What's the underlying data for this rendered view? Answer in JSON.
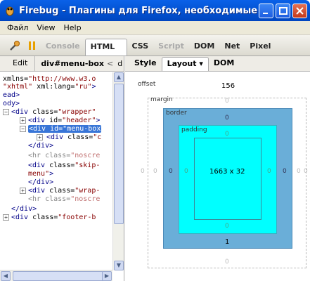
{
  "window": {
    "title": "Firebug - Плагины для Firefox, необходимые веб-..."
  },
  "menu": [
    "Файл",
    "View",
    "Help"
  ],
  "toolbar": {
    "tabs": [
      {
        "label": "Console",
        "state": "disabled"
      },
      {
        "label": "HTML ▾",
        "state": "selected"
      },
      {
        "label": "CSS",
        "state": "normal"
      },
      {
        "label": "Script",
        "state": "disabled"
      },
      {
        "label": "DOM",
        "state": "normal"
      },
      {
        "label": "Net",
        "state": "normal"
      },
      {
        "label": "Pixel Perfect",
        "state": "normal"
      }
    ]
  },
  "html_panel": {
    "edit_label": "Edit",
    "breadcrumb": "div#menu-box",
    "breadcrumb_more": "<",
    "breadcrumb_next": "d",
    "lines": [
      {
        "parts": [
          {
            "t": "xmlns=",
            "c": "attr"
          },
          {
            "t": "\"http://www.w3.o",
            "c": "val"
          }
        ]
      },
      {
        "parts": [
          {
            "t": "\"xhtml\"",
            "c": "val"
          },
          {
            "t": " xml:lang=",
            "c": "attr"
          },
          {
            "t": "\"ru\"",
            "c": "val"
          },
          {
            "t": ">",
            "c": "tag"
          }
        ]
      },
      {
        "parts": [
          {
            "t": "ead>",
            "c": "tag"
          }
        ]
      },
      {
        "parts": [
          {
            "t": "ody>",
            "c": "tag"
          }
        ]
      },
      {
        "parts": [
          {
            "t": "<div ",
            "c": "tag"
          },
          {
            "t": "class=",
            "c": "attr"
          },
          {
            "t": "\"wrapper\"",
            "c": "val"
          }
        ]
      },
      {
        "parts": [
          {
            "t": "<div ",
            "c": "tag"
          },
          {
            "t": "id=",
            "c": "attr"
          },
          {
            "t": "\"header\"",
            "c": "val"
          },
          {
            "t": ">",
            "c": "tag"
          }
        ]
      },
      {
        "parts": [
          {
            "t": "<div id=\"menu-box",
            "c": "sel"
          }
        ]
      },
      {
        "parts": [
          {
            "t": "<div ",
            "c": "tag"
          },
          {
            "t": "class=",
            "c": "attr"
          },
          {
            "t": "\"c",
            "c": "val"
          }
        ]
      },
      {
        "parts": [
          {
            "t": "</div>",
            "c": "tag"
          }
        ]
      },
      {
        "parts": [
          {
            "t": "<hr ",
            "c": "grey"
          },
          {
            "t": "class=",
            "c": "grey"
          },
          {
            "t": "\"noscre",
            "c": "greyval"
          }
        ]
      },
      {
        "parts": [
          {
            "t": "<div ",
            "c": "tag"
          },
          {
            "t": "class=",
            "c": "attr"
          },
          {
            "t": "\"skip-",
            "c": "val"
          }
        ]
      },
      {
        "parts": [
          {
            "t": "menu\"",
            "c": "val"
          },
          {
            "t": ">",
            "c": "tag"
          }
        ]
      },
      {
        "parts": [
          {
            "t": "</div>",
            "c": "tag"
          }
        ]
      },
      {
        "parts": [
          {
            "t": "<div ",
            "c": "tag"
          },
          {
            "t": "class=",
            "c": "attr"
          },
          {
            "t": "\"wrap-",
            "c": "val"
          }
        ]
      },
      {
        "parts": [
          {
            "t": "<hr ",
            "c": "grey"
          },
          {
            "t": "class=",
            "c": "grey"
          },
          {
            "t": "\"noscre",
            "c": "greyval"
          }
        ]
      },
      {
        "parts": [
          {
            "t": "</div>",
            "c": "tag"
          }
        ]
      },
      {
        "parts": [
          {
            "t": "<div ",
            "c": "tag"
          },
          {
            "t": "class=",
            "c": "attr"
          },
          {
            "t": "\"footer-b",
            "c": "val"
          }
        ]
      }
    ]
  },
  "side_panel": {
    "tabs": [
      {
        "label": "Style",
        "state": "normal"
      },
      {
        "label": "Layout ▾",
        "state": "selected"
      },
      {
        "label": "DOM",
        "state": "normal"
      }
    ]
  },
  "layout": {
    "offset_label": "offset",
    "offset_value": "156",
    "margin_label": "margin",
    "margin_top": "0",
    "margin_right": "0",
    "margin_bottom": "0",
    "margin_left": "0",
    "border_label": "border",
    "border_top": "0",
    "border_right": "0",
    "border_bottom": "1",
    "border_left": "0",
    "padding_label": "padding",
    "padding_top": "0",
    "padding_right": "0",
    "padding_bottom": "0",
    "padding_left": "0",
    "content_size": "1663 x 32",
    "offset_left": "0",
    "offset_right": "0",
    "colors": {
      "border": "#6aaed8",
      "padding": "#00ffff",
      "content": "#00ffff"
    }
  }
}
